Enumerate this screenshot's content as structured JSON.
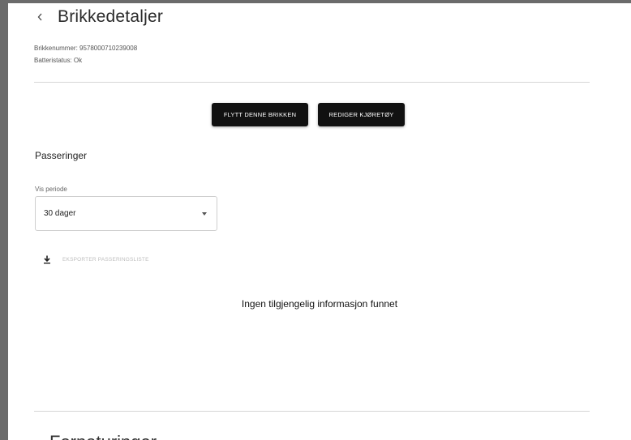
{
  "header": {
    "back_icon": "chevron-left-icon",
    "title": "Brikkedetaljer"
  },
  "meta": {
    "chip_number": "Brikkenummer: 9578000710239008",
    "battery_status": "Batteristatus: Ok"
  },
  "actions": {
    "move_label": "FLYTT DENNE BRIKKEN",
    "edit_label": "REDIGER KJØRETØY"
  },
  "passages": {
    "title": "Passeringer",
    "period_label": "Vis periode",
    "period_value": "30 dager",
    "export_icon": "download-icon",
    "export_label": "EKSPORTER PASSERINGSLISTE",
    "empty_message": "Ingen tilgjengelig informasjon funnet"
  },
  "next_section": {
    "title": "Fornaturinger"
  }
}
